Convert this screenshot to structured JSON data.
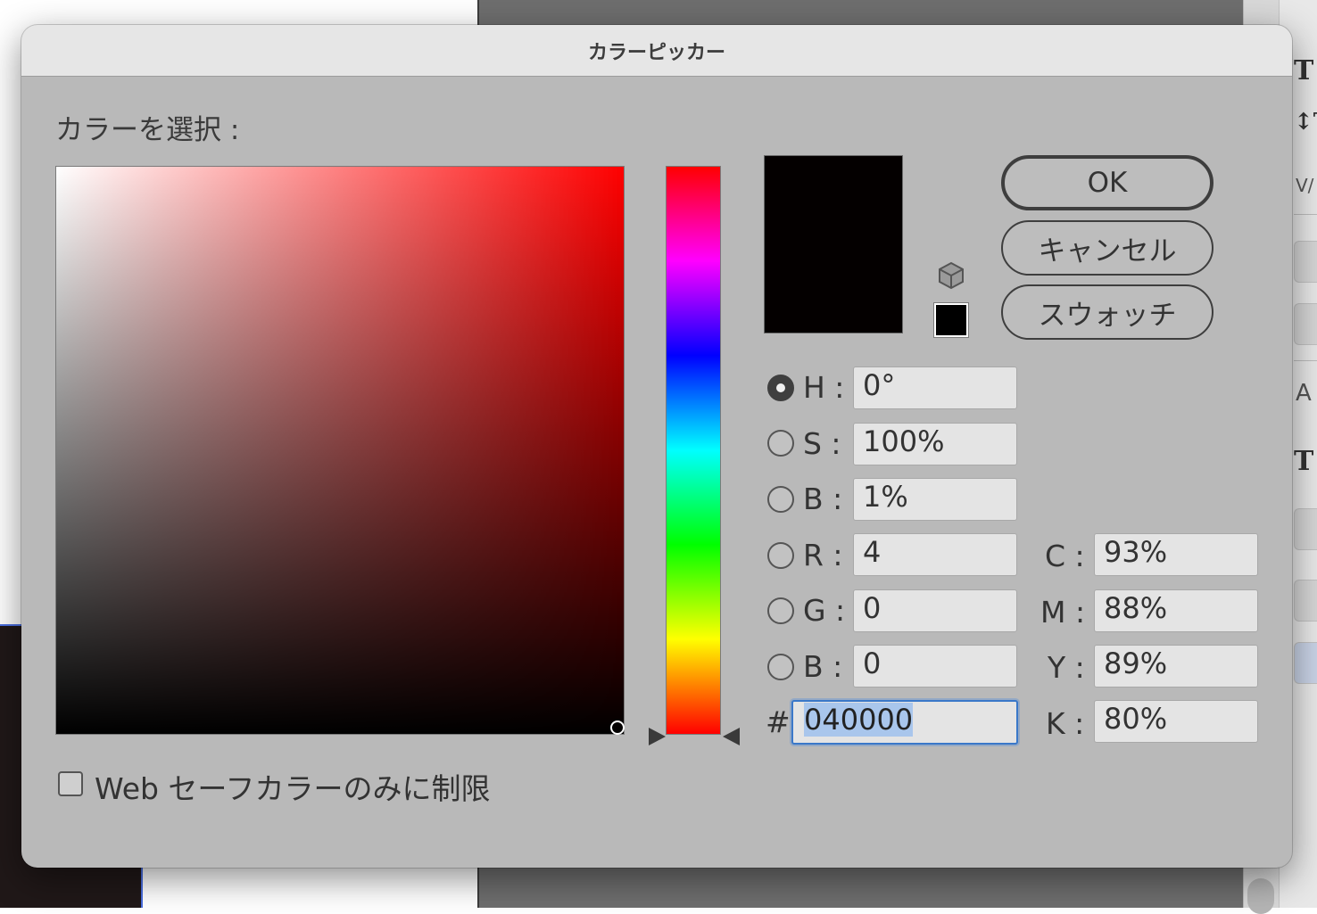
{
  "dialog": {
    "title": "カラーピッカー",
    "select_label": "カラーを選択 :",
    "buttons": {
      "ok": "OK",
      "cancel": "キャンセル",
      "swatches": "スウォッチ"
    },
    "fields": {
      "h": {
        "label": "H :",
        "value": "0°"
      },
      "s": {
        "label": "S :",
        "value": "100%"
      },
      "b": {
        "label": "B :",
        "value": "1%"
      },
      "r": {
        "label": "R :",
        "value": "4"
      },
      "g": {
        "label": "G :",
        "value": "0"
      },
      "b2": {
        "label": "B :",
        "value": "0"
      },
      "hex": {
        "label": "#",
        "value": "040000"
      },
      "c": {
        "label": "C :",
        "value": "93%"
      },
      "m": {
        "label": "M :",
        "value": "88%"
      },
      "y": {
        "label": "Y :",
        "value": "89%"
      },
      "k": {
        "label": "K :",
        "value": "80%"
      }
    },
    "selected_mode": "H",
    "web_safe": {
      "label": "Web セーフカラーのみに制限",
      "checked": false
    },
    "colors": {
      "new": "#040000",
      "current": "#040000",
      "hue_base": "#ff0000",
      "hex_focus": "#3a78c9"
    }
  },
  "background_panel": {
    "items": [
      "T",
      "↕T",
      "V/",
      "A",
      "T"
    ]
  }
}
